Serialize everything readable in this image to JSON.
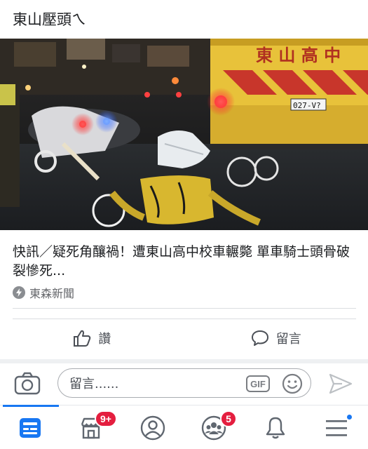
{
  "post": {
    "text": "東山壓頭ㄟ"
  },
  "link": {
    "image_alt": "夜間車禍現場：東山高中校車與倒地機車",
    "bus_sign": "東 山 高 中",
    "bus_plate": "027-V?",
    "title": "快訊／疑死角釀禍！遭東山高中校車輾斃 單車騎士頭骨破裂慘死...",
    "source": "東森新聞"
  },
  "actions": {
    "like_label": "讚",
    "comment_label": "留言"
  },
  "composer": {
    "placeholder": "留言......",
    "gif_label": "GIF"
  },
  "tabbar": {
    "tabs": [
      {
        "name": "news-feed",
        "icon": "news-feed-icon",
        "badge": ""
      },
      {
        "name": "marketplace",
        "icon": "marketplace-icon",
        "badge": "9+"
      },
      {
        "name": "profile",
        "icon": "profile-icon",
        "badge": ""
      },
      {
        "name": "groups",
        "icon": "groups-icon",
        "badge": "5"
      },
      {
        "name": "notifications",
        "icon": "bell-icon",
        "badge": ""
      },
      {
        "name": "menu",
        "icon": "menu-icon",
        "badge": ""
      }
    ],
    "marketplace_badge": "9+",
    "groups_badge": "5"
  },
  "colors": {
    "accent": "#1877f2",
    "badge": "#e41e3f",
    "bus_yellow": "#e8c23a",
    "bus_red": "#c8362b"
  }
}
